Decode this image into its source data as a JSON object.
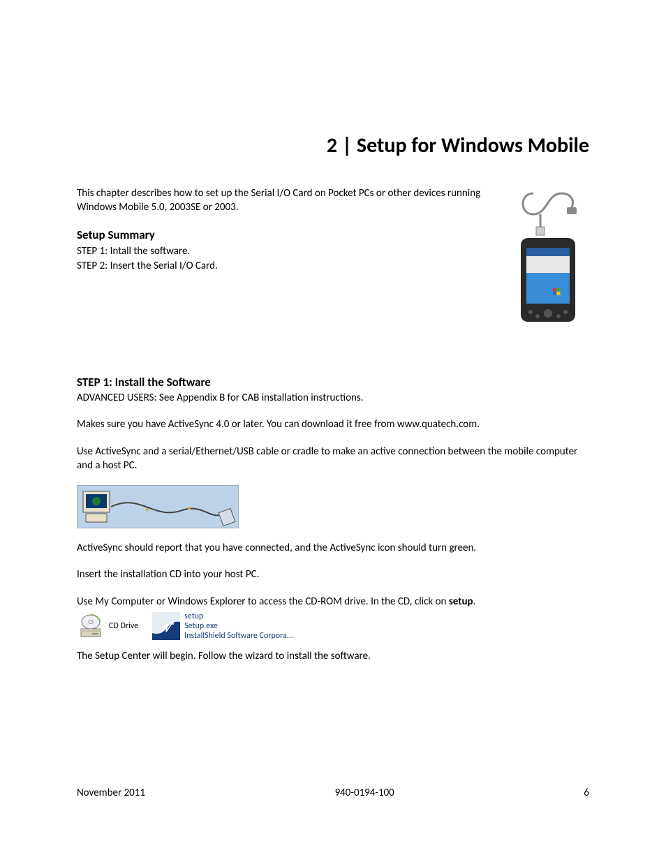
{
  "chapter_title": "2 | Setup for Windows Mobile",
  "intro": "This chapter describes how to set up the Serial I/O Card on Pocket PCs or other devices running Windows Mobile 5.0, 2003SE or 2003.",
  "summary": {
    "heading": "Setup Summary",
    "step1": "STEP 1: Intall the software.",
    "step2": "STEP 2: Insert the Serial I/O Card."
  },
  "step1": {
    "heading": "STEP 1: Install the Software",
    "adv": "ADVANCED USERS: See Appendix B for CAB installation instructions.",
    "p1": "Makes sure you have ActiveSync 4.0 or later. You can download it free from www.quatech.com.",
    "p2": "Use ActiveSync and a serial/Ethernet/USB cable or cradle to make an active connection between the mobile computer and a host PC.",
    "p3": "ActiveSync should report that you have connected, and the ActiveSync icon should turn green.",
    "p4": "Insert the installation CD into your host PC.",
    "p5_pre": "Use My Computer or Windows Explorer to access the CD-ROM drive. In the CD, click on ",
    "p5_bold": "setup",
    "p5_post": ".",
    "cd_label": "CD Drive",
    "setup_line1": "setup",
    "setup_line2": "Setup.exe",
    "setup_line3": "InstallShield Software Corpora...",
    "p6": "The Setup Center will begin. Follow the wizard to install the software."
  },
  "footer": {
    "date": "November 2011",
    "docnum": "940-0194-100",
    "page": "6"
  }
}
